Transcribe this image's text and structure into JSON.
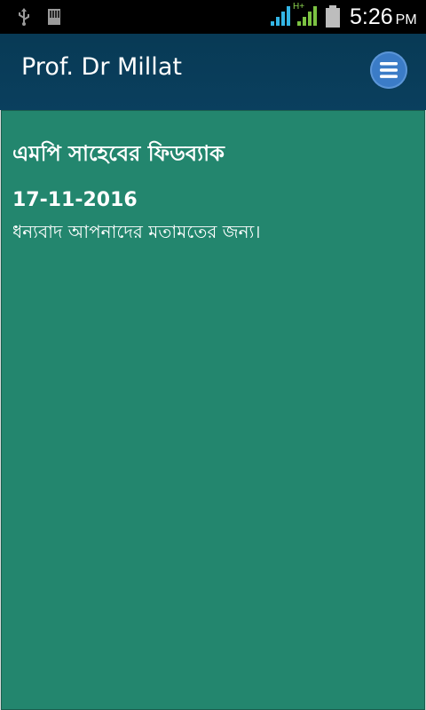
{
  "status_bar": {
    "time": "5:26",
    "ampm": "PM",
    "network_label": "H+",
    "icons": [
      "usb-icon",
      "sdcard-icon",
      "signal-icon",
      "signal-hplus-icon",
      "battery-icon"
    ]
  },
  "app_bar": {
    "title": "Prof. Dr Millat",
    "menu_icon": "hamburger-icon"
  },
  "content": {
    "heading": "এমপি সাহেবের ফিডব্যাক",
    "date": "17-11-2016",
    "message": "ধন্যবাদ আপনাদের মতামতের জন্য।"
  },
  "colors": {
    "app_bar": "#0a3f5e",
    "content_bg": "#23866e",
    "menu_button": "#3b7cc7"
  }
}
